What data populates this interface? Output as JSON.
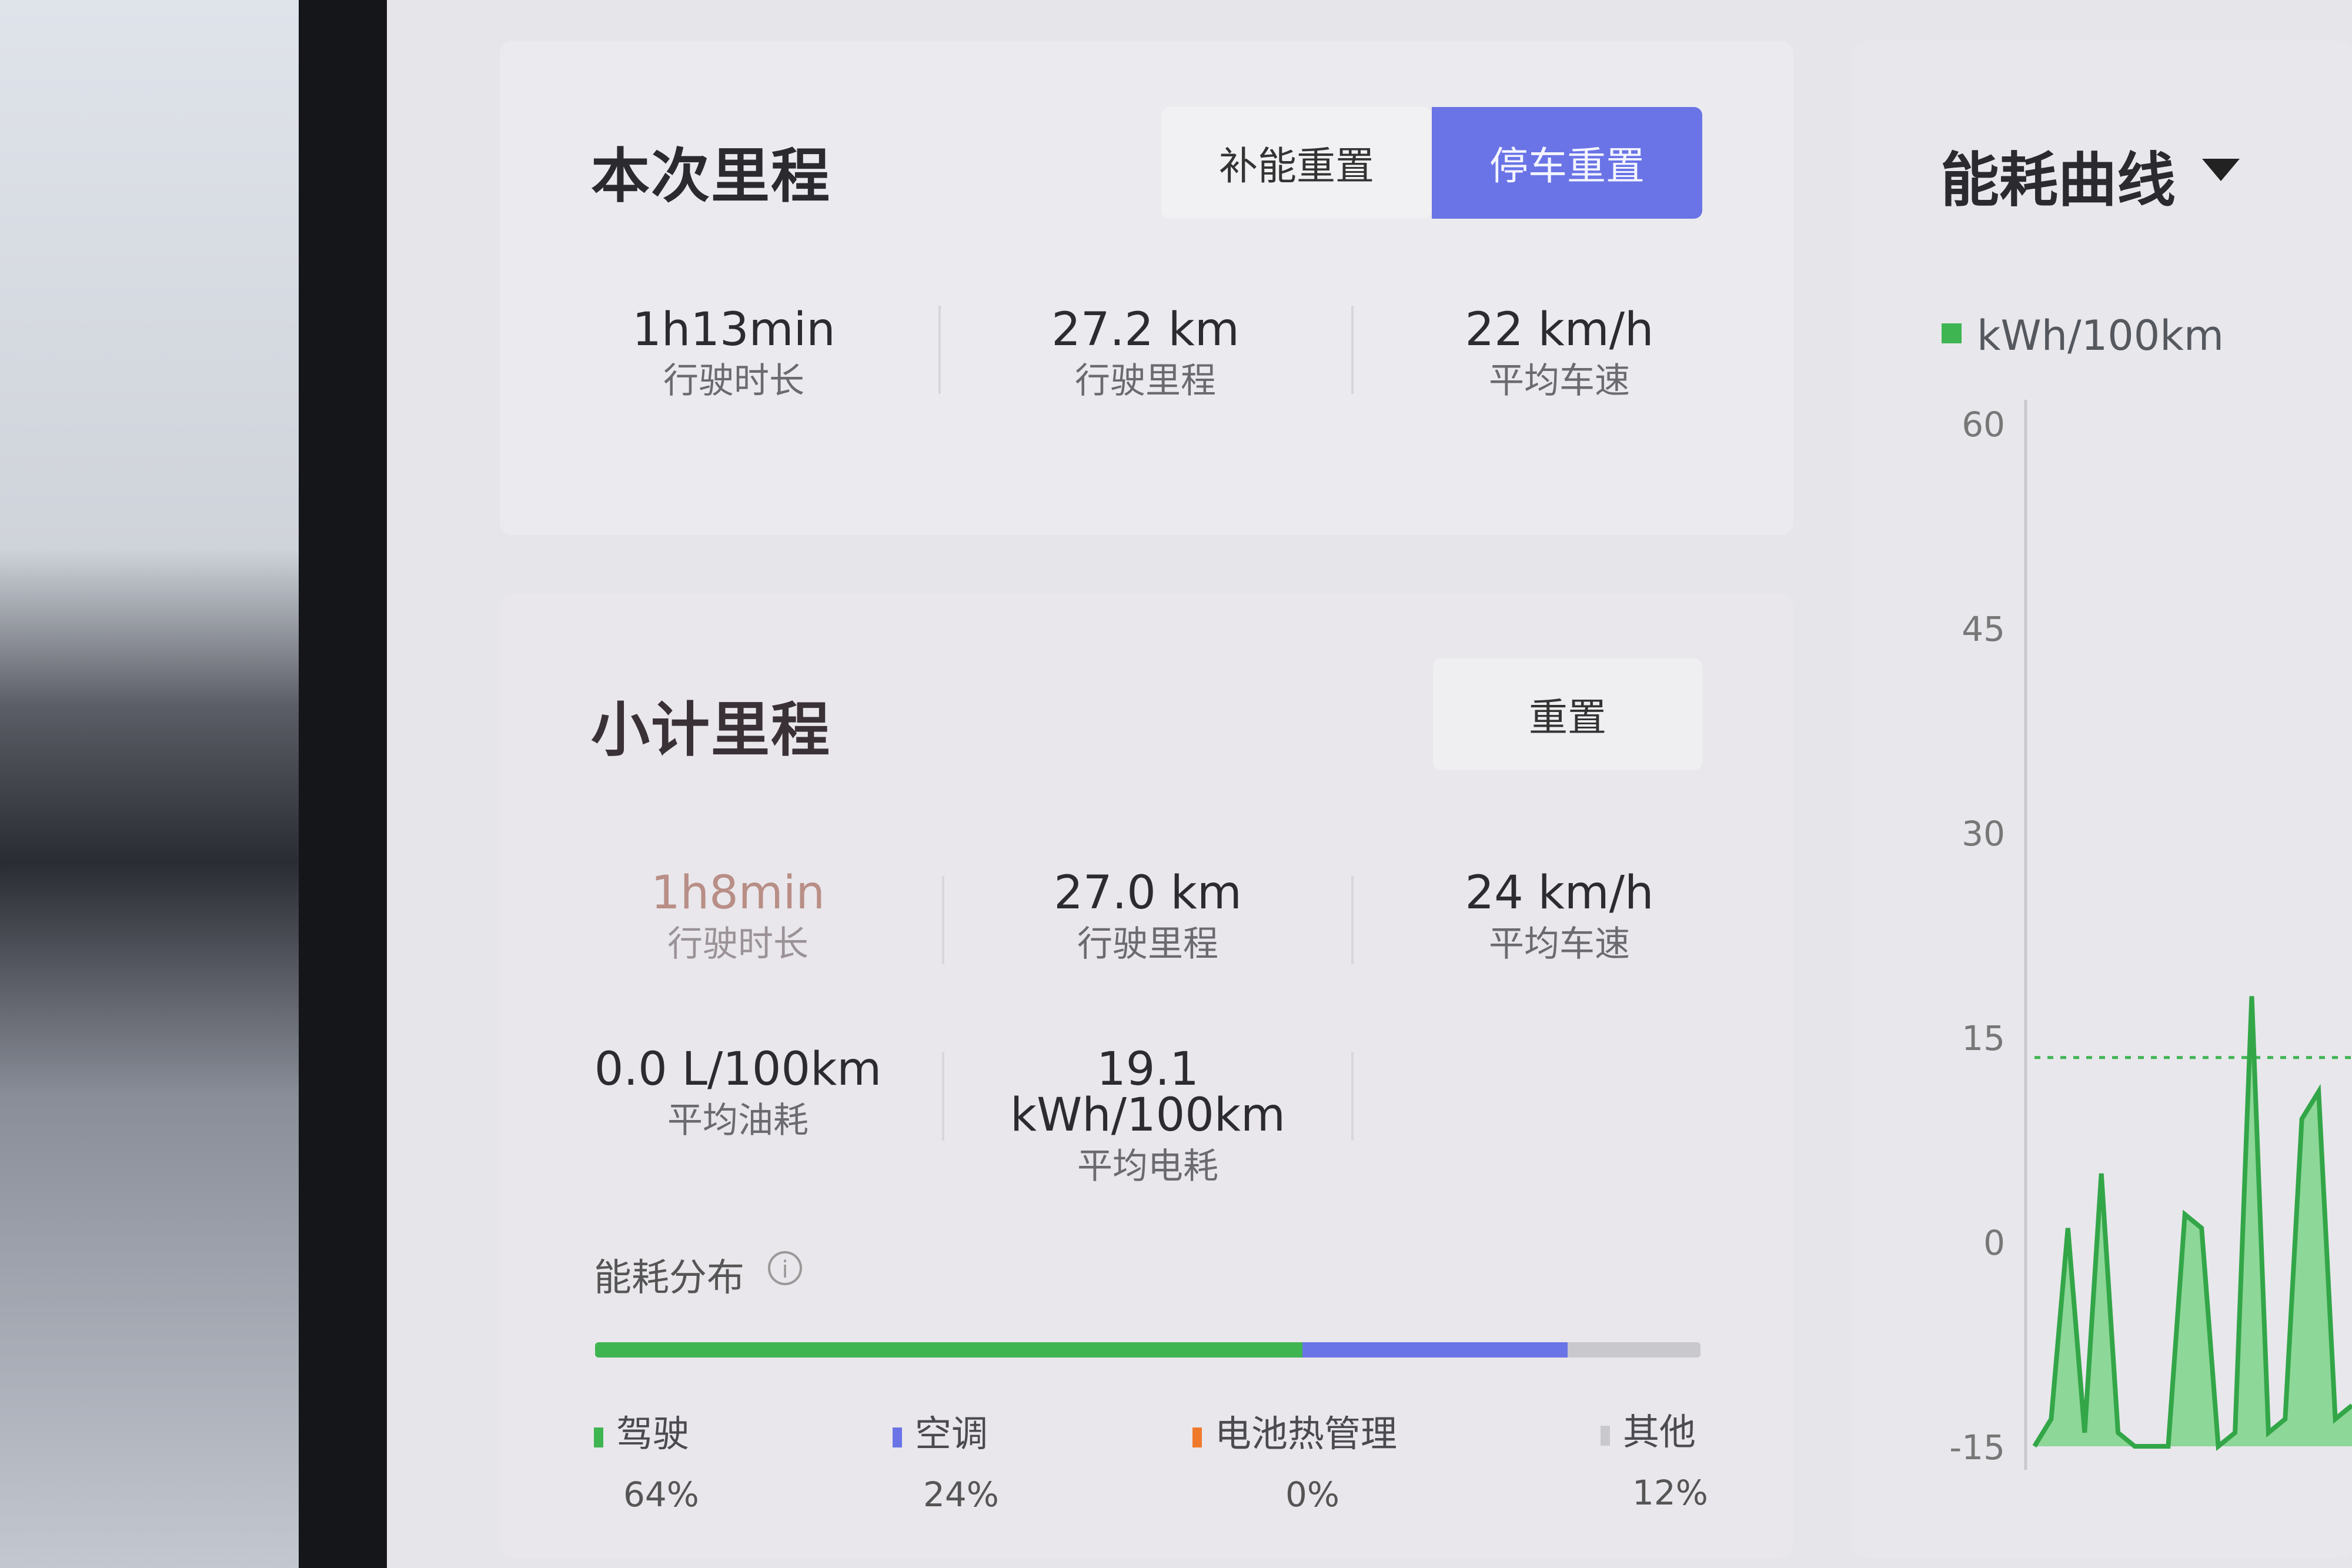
{
  "trip": {
    "title": "本次里程",
    "btn_refuel_reset": "补能重置",
    "btn_park_reset": "停车重置",
    "stats": [
      {
        "value": "1h13min",
        "label": "行驶时长"
      },
      {
        "value": "27.2 km",
        "label": "行驶里程"
      },
      {
        "value": "22 km/h",
        "label": "平均车速"
      }
    ]
  },
  "subtotal": {
    "title": "小计里程",
    "btn_reset": "重置",
    "stats": [
      {
        "value": "1h8min",
        "label": "行驶时长"
      },
      {
        "value": "27.0 km",
        "label": "行驶里程"
      },
      {
        "value": "24 km/h",
        "label": "平均车速"
      },
      {
        "value": "0.0 L/100km",
        "label": "平均油耗"
      },
      {
        "value": "19.1 kWh/100km",
        "label": "平均电耗"
      }
    ],
    "distribution": {
      "title": "能耗分布",
      "info_icon": "info-icon",
      "items": [
        {
          "label": "驾驶",
          "percent": "64%",
          "fraction": 0.64,
          "color": "#3fb552"
        },
        {
          "label": "空调",
          "percent": "24%",
          "fraction": 0.24,
          "color": "#6a74e6"
        },
        {
          "label": "电池热管理",
          "percent": "0%",
          "fraction": 0.0,
          "color": "#f07a2c"
        },
        {
          "label": "其他",
          "percent": "12%",
          "fraction": 0.12,
          "color": "#c9c8cd"
        }
      ]
    }
  },
  "chart_panel": {
    "title": "能耗曲线",
    "dropdown_icon": "caret-down-icon"
  },
  "chart_data": {
    "type": "area",
    "series": [
      {
        "name": "kWh/100km",
        "color": "#3fb552",
        "values": [
          -15,
          -13,
          1,
          -14,
          5,
          -14,
          -15,
          -15,
          -15,
          2,
          1,
          -15,
          -14,
          18,
          -14,
          -13,
          9,
          11,
          -13,
          -12
        ]
      }
    ],
    "yticks": [
      "60",
      "45",
      "30",
      "15",
      "0",
      "-15"
    ],
    "ylim": [
      -15,
      60
    ],
    "reference_line": 13.5,
    "grid": false
  }
}
